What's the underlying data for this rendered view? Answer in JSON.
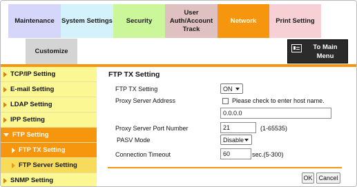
{
  "tabs": {
    "maintenance": "Maintenance",
    "system_settings": "System Settings",
    "security": "Security",
    "user_auth_line1": "User",
    "user_auth_line2": "Auth/Account",
    "user_auth_line3": "Track",
    "network": "Network",
    "print_setting": "Print Setting",
    "customize": "Customize"
  },
  "main_menu": {
    "line1": "To Main",
    "line2": "Menu"
  },
  "sidebar": {
    "items": [
      {
        "label": "TCP/IP Setting"
      },
      {
        "label": "E-mail Setting"
      },
      {
        "label": "LDAP Setting"
      },
      {
        "label": "IPP Setting"
      },
      {
        "label": "FTP Setting"
      },
      {
        "label": "FTP TX Setting"
      },
      {
        "label": "FTP Server Setting"
      },
      {
        "label": "SNMP Setting"
      }
    ]
  },
  "form": {
    "title": "FTP TX Setting",
    "ftp_tx_label": "FTP TX Setting",
    "ftp_tx_value": "ON",
    "proxy_address_label": "Proxy Server Address",
    "proxy_checkbox_label": "Please check to enter host name.",
    "proxy_address_value": "0.0.0.0",
    "proxy_port_label": "Proxy Server Port Number",
    "proxy_port_value": "21",
    "proxy_port_range": "(1-65535)",
    "pasv_label": "PASV Mode",
    "pasv_value": "Disable",
    "timeout_label": "Connection Timeout",
    "timeout_value": "60",
    "timeout_unit": "sec.(5-300)"
  },
  "buttons": {
    "ok": "OK",
    "cancel": "Cancel"
  },
  "colors": {
    "accent": "#f6960f",
    "sidebar_bg": "#fbf793",
    "sub_bg": "#f6dc5a"
  }
}
